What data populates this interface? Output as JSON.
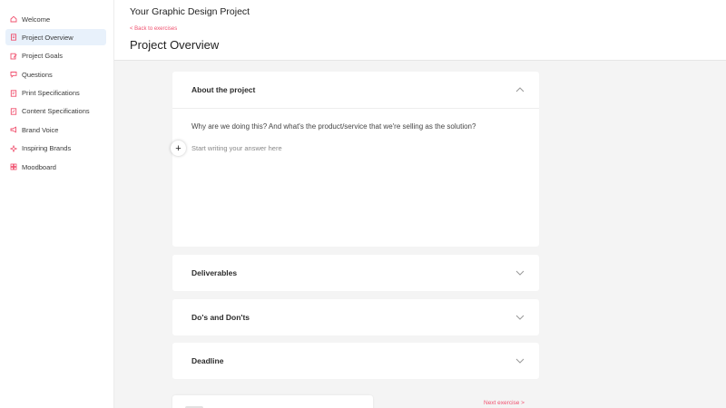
{
  "sidebar": {
    "accent": "#f0506e",
    "active_bg": "#e8f1fb",
    "items": [
      {
        "label": "Welcome",
        "icon": "home-icon"
      },
      {
        "label": "Project Overview",
        "icon": "document-icon"
      },
      {
        "label": "Project Goals",
        "icon": "pencil-note-icon"
      },
      {
        "label": "Questions",
        "icon": "speech-bubble-icon"
      },
      {
        "label": "Print Specifications",
        "icon": "print-doc-icon"
      },
      {
        "label": "Content Specifications",
        "icon": "edit-doc-icon"
      },
      {
        "label": "Brand Voice",
        "icon": "megaphone-icon"
      },
      {
        "label": "Inspiring Brands",
        "icon": "sparkle-icon"
      },
      {
        "label": "Moodboard",
        "icon": "image-grid-icon"
      }
    ]
  },
  "header": {
    "project_title": "Your Graphic Design Project",
    "back_link": "< Back to exercises",
    "page_title": "Project Overview"
  },
  "sections": [
    {
      "title": "About the project",
      "expanded": true
    },
    {
      "title": "Deliverables",
      "expanded": false
    },
    {
      "title": "Do's and Don'ts",
      "expanded": false
    },
    {
      "title": "Deadline",
      "expanded": false
    }
  ],
  "about": {
    "question": "Why are we doing this? And what's the product/service that we're selling as the solution?",
    "answer_placeholder": "Start writing your answer here",
    "plus_symbol": "+"
  },
  "footer": {
    "next_link": "Next exercise >"
  }
}
